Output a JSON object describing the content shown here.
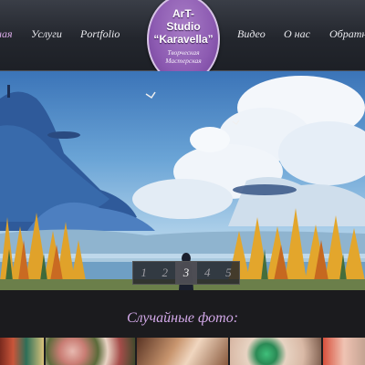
{
  "nav": {
    "items": [
      {
        "label": "ная",
        "active": true
      },
      {
        "label": "Услуги",
        "active": false
      },
      {
        "label": "Portfolio",
        "active": false
      },
      {
        "label": "Видео",
        "active": false
      },
      {
        "label": "О нас",
        "active": false
      },
      {
        "label": "Обратна",
        "active": false
      }
    ]
  },
  "logo": {
    "line1": "ArT-",
    "line2": "Studio",
    "line3": "“Karavella”",
    "sub1": "Творческая",
    "sub2": "Мастерская"
  },
  "slider": {
    "pages": [
      "1",
      "2",
      "3",
      "4",
      "5"
    ],
    "current": "3"
  },
  "random": {
    "title": "Случайные фото:"
  },
  "colors": {
    "accent": "#d2a8e8",
    "logo": "#8d5bb2"
  }
}
